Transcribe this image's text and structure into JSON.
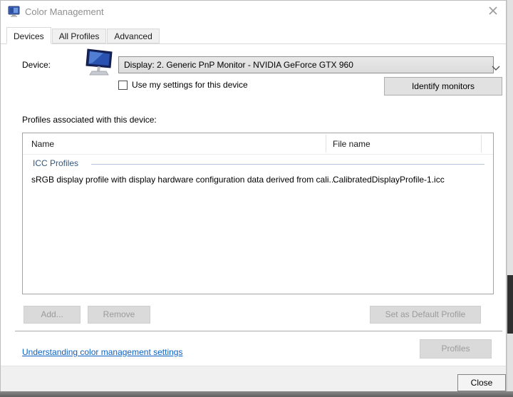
{
  "window": {
    "title": "Color Management"
  },
  "tabs": {
    "devices": "Devices",
    "all_profiles": "All Profiles",
    "advanced": "Advanced",
    "active_tab": "Devices"
  },
  "device": {
    "label": "Device:",
    "selected": "Display: 2. Generic PnP Monitor - NVIDIA GeForce GTX 960",
    "use_settings_label": "Use my settings for this device",
    "use_settings_checked": false,
    "identify_button": "Identify monitors"
  },
  "profiles_section": {
    "label": "Profiles associated with this device:",
    "columns": [
      "Name",
      "File name"
    ],
    "group_header": "ICC Profiles",
    "rows": [
      {
        "name": "sRGB display profile with display hardware configuration data derived from cali...",
        "file": "CalibratedDisplayProfile-1.icc"
      }
    ],
    "add_button": "Add...",
    "remove_button": "Remove",
    "set_default_button": "Set as Default Profile"
  },
  "help_link": "Understanding color management settings",
  "profiles_button": "Profiles",
  "close_button": "Close",
  "colors": {
    "group_header_blue": "#31577e",
    "link_blue": "#0b62c4",
    "monitor_icon_blue": "#2a52b0",
    "footer_gray": "#f0f0f0"
  }
}
